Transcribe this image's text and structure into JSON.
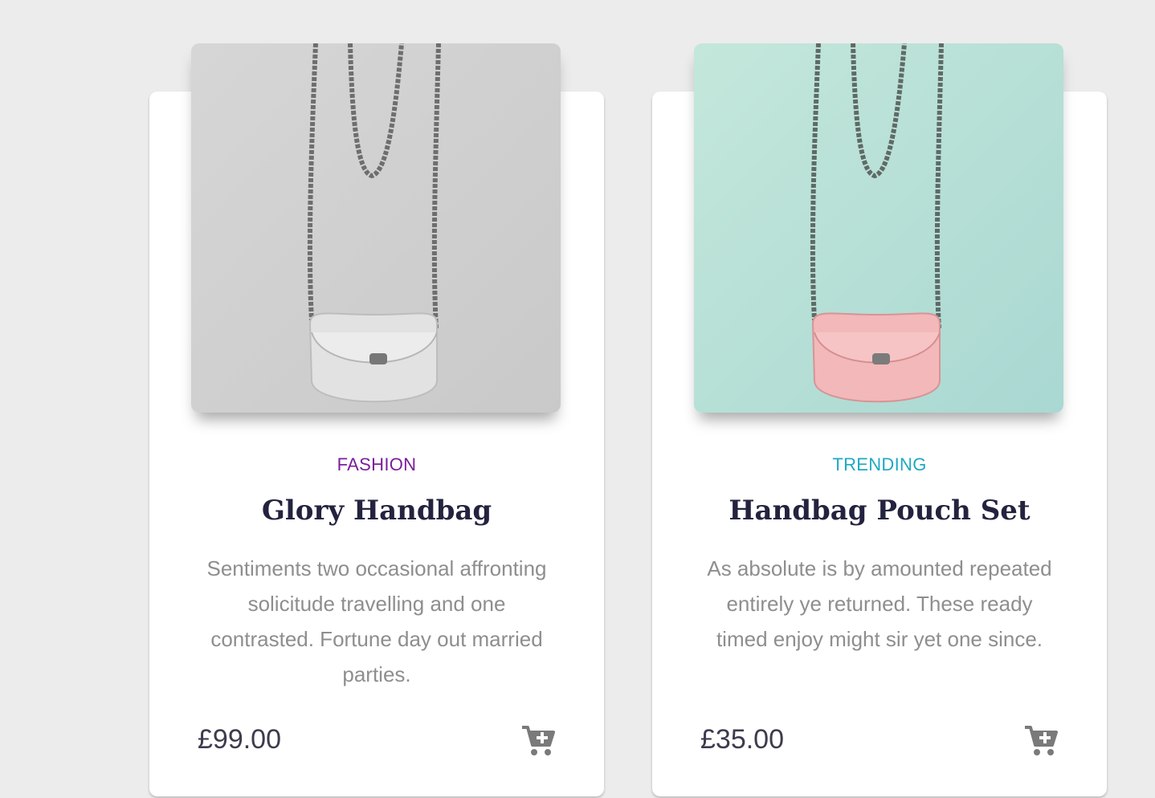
{
  "products": [
    {
      "category": "FASHION",
      "category_color": "#7b1f9a",
      "title": "Glory Handbag",
      "description": "Sentiments two occasional affronting solicitude travelling and one contrasted. Fortune day out married parties.",
      "price": "£99.00",
      "image_variant": "grey"
    },
    {
      "category": "TRENDING",
      "category_color": "#1ea9c2",
      "title": "Handbag Pouch Set",
      "description": "As absolute is by amounted repeated entirely ye returned. These ready timed enjoy might sir yet one since.",
      "price": "£35.00",
      "image_variant": "mint"
    }
  ],
  "icons": {
    "cart": "add-to-cart-icon"
  }
}
